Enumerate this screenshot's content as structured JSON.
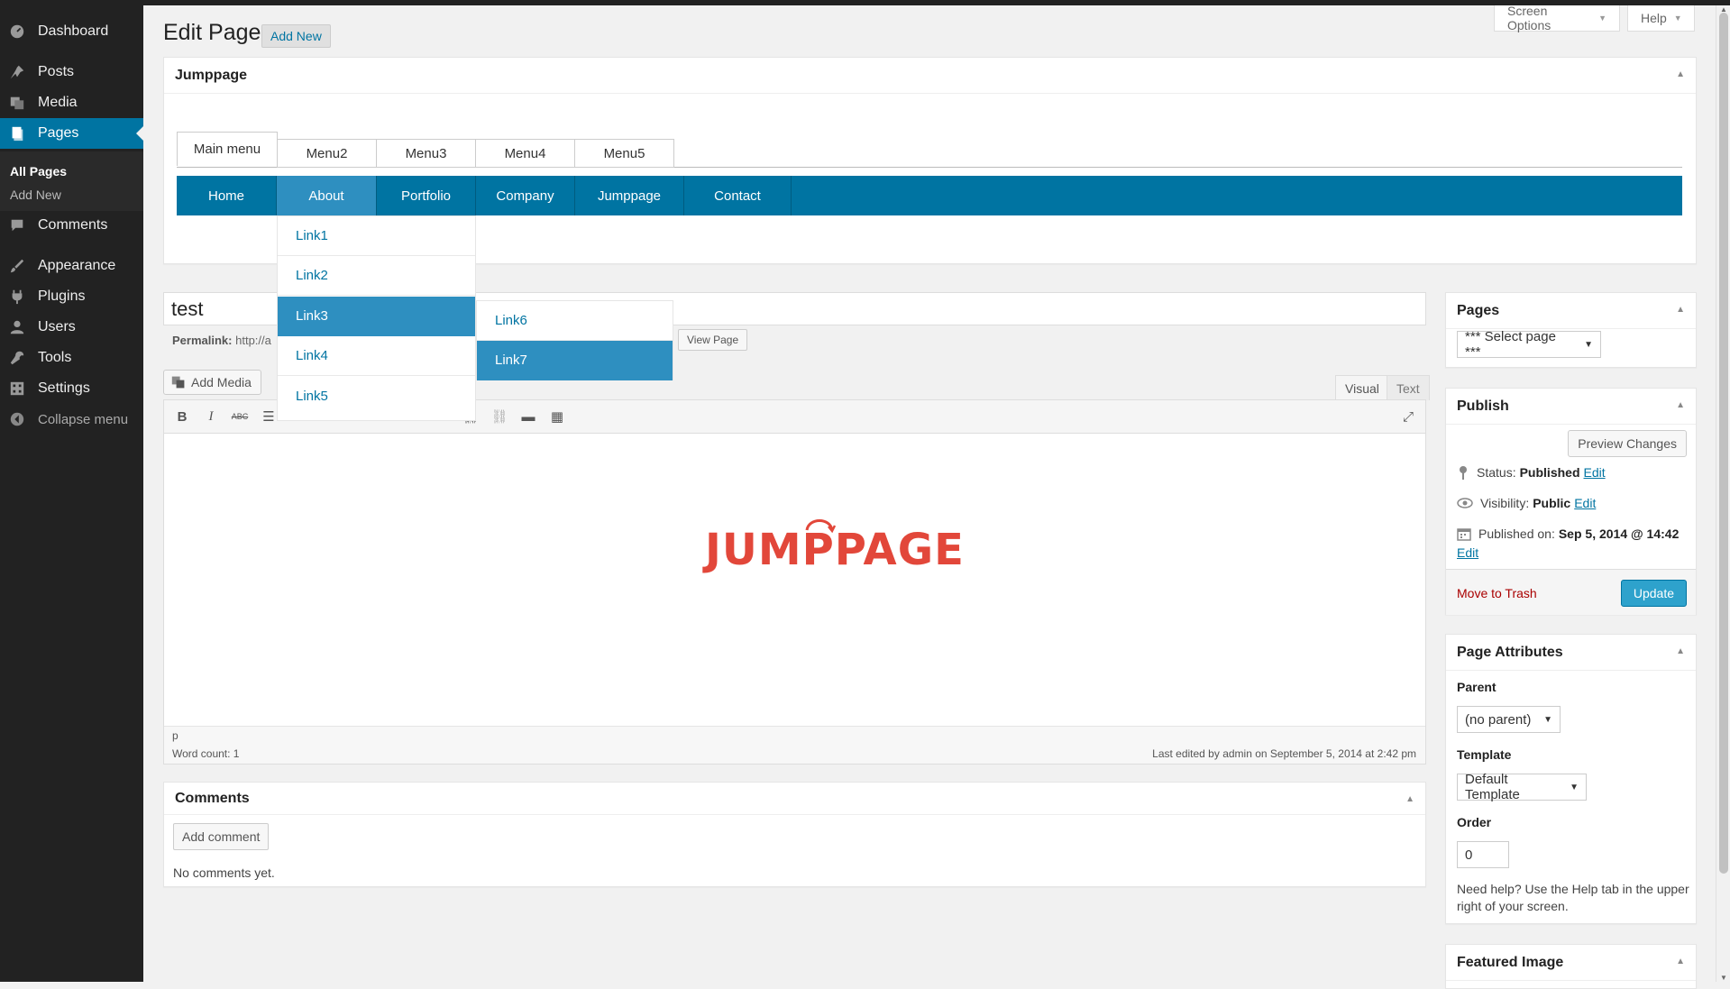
{
  "sidebar": {
    "items": [
      {
        "label": "Dashboard",
        "icon": "dashboard-icon"
      },
      {
        "label": "Posts",
        "icon": "pin-icon"
      },
      {
        "label": "Media",
        "icon": "media-icon"
      },
      {
        "label": "Pages",
        "icon": "pages-icon"
      },
      {
        "label": "Comments",
        "icon": "comment-icon"
      },
      {
        "label": "Appearance",
        "icon": "brush-icon"
      },
      {
        "label": "Plugins",
        "icon": "plug-icon"
      },
      {
        "label": "Users",
        "icon": "user-icon"
      },
      {
        "label": "Tools",
        "icon": "wrench-icon"
      },
      {
        "label": "Settings",
        "icon": "settings-icon"
      }
    ],
    "submenu": {
      "all_pages": "All Pages",
      "add_new": "Add New"
    },
    "collapse": "Collapse menu"
  },
  "header": {
    "screen_options": "Screen Options",
    "help": "Help",
    "title": "Edit Page",
    "add_new": "Add New"
  },
  "jumppage": {
    "box_title": "Jumppage",
    "menu_tabs": [
      "Main menu",
      "Menu2",
      "Menu3",
      "Menu4",
      "Menu5"
    ],
    "nav": [
      "Home",
      "About",
      "Portfolio",
      "Company",
      "Jumppage",
      "Contact"
    ],
    "dropdown": [
      "Link1",
      "Link2",
      "Link3",
      "Link4",
      "Link5"
    ],
    "subdropdown": [
      "Link6",
      "Link7"
    ]
  },
  "post": {
    "title": "test",
    "permalink_label": "Permalink:",
    "permalink_value": "http://a",
    "view_page": "View Page"
  },
  "editor": {
    "add_media": "Add Media",
    "tab_visual": "Visual",
    "tab_text": "Text",
    "logo_text": "JUMPPAGE",
    "path": "p",
    "word_count": "Word count: 1",
    "last_edited": "Last edited by admin on September 5, 2014 at 2:42 pm",
    "toolbar": [
      "bold-icon",
      "italic-icon",
      "strikethrough-icon",
      "bulleted-list-icon",
      "align-left-icon",
      "align-center-icon",
      "align-right-icon",
      "link-icon",
      "unlink-icon",
      "more-tag-icon",
      "kitchen-sink-icon",
      "fullscreen-icon"
    ]
  },
  "comments": {
    "title": "Comments",
    "add_comment": "Add comment",
    "none": "No comments yet."
  },
  "pages_box": {
    "title": "Pages",
    "select": "*** Select page ***"
  },
  "publish": {
    "title": "Publish",
    "preview": "Preview Changes",
    "status_label": "Status:",
    "status_value": "Published",
    "visibility_label": "Visibility:",
    "visibility_value": "Public",
    "published_label": "Published on:",
    "published_value": "Sep 5, 2014 @ 14:42",
    "edit": "Edit",
    "trash": "Move to Trash",
    "update": "Update"
  },
  "attributes": {
    "title": "Page Attributes",
    "parent_label": "Parent",
    "parent_value": "(no parent)",
    "template_label": "Template",
    "template_value": "Default Template",
    "order_label": "Order",
    "order_value": "0",
    "help": "Need help? Use the Help tab in the upper right of your screen."
  },
  "featured": {
    "title": "Featured Image"
  },
  "colors": {
    "accent": "#0074a2",
    "highlight": "#2e8fc0",
    "logo": "#e2473a",
    "sidebar": "#222222"
  }
}
